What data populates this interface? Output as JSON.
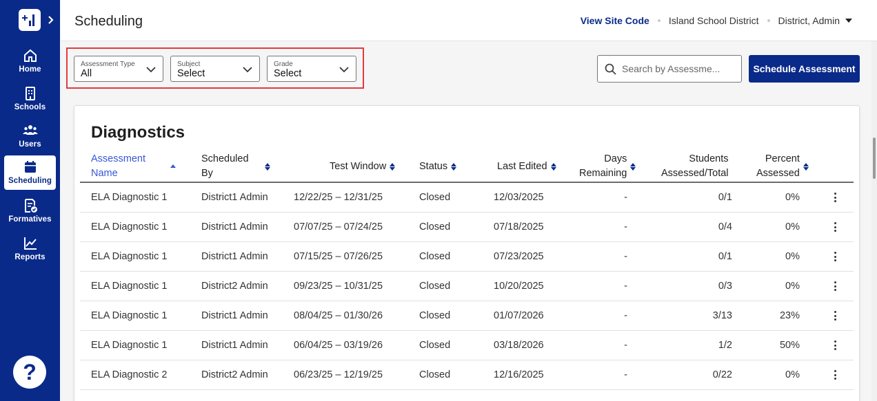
{
  "sidebar": {
    "items": [
      {
        "label": "Home",
        "icon": "home-icon"
      },
      {
        "label": "Schools",
        "icon": "school-building-icon"
      },
      {
        "label": "Users",
        "icon": "users-icon"
      },
      {
        "label": "Scheduling",
        "icon": "calendar-icon",
        "active": true
      },
      {
        "label": "Formatives",
        "icon": "document-check-icon"
      },
      {
        "label": "Reports",
        "icon": "line-chart-icon"
      }
    ],
    "help_label": "?"
  },
  "header": {
    "title": "Scheduling",
    "view_site_code": "View Site Code",
    "district": "Island School District",
    "user": "District, Admin"
  },
  "filters": {
    "assessment_type": {
      "label": "Assessment Type",
      "value": "All"
    },
    "subject": {
      "label": "Subject",
      "value": "Select"
    },
    "grade": {
      "label": "Grade",
      "value": "Select"
    }
  },
  "search": {
    "placeholder": "Search by Assessme..."
  },
  "actions": {
    "schedule_label": "Schedule Assessment"
  },
  "table": {
    "title": "Diagnostics",
    "columns": {
      "assessment_name_1": "Assessment",
      "assessment_name_2": "Name",
      "scheduled_by_1": "Scheduled",
      "scheduled_by_2": "By",
      "test_window": "Test Window",
      "status": "Status",
      "last_edited": "Last Edited",
      "days_remaining_1": "Days",
      "days_remaining_2": "Remaining",
      "students_1": "Students",
      "students_2": "Assessed/Total",
      "percent_1": "Percent",
      "percent_2": "Assessed"
    },
    "rows": [
      {
        "name": "ELA Diagnostic 1",
        "by": "District1 Admin",
        "window": "12/22/25 – 12/31/25",
        "status": "Closed",
        "edited": "12/03/2025",
        "days": "-",
        "students": "0/1",
        "percent": "0%"
      },
      {
        "name": "ELA Diagnostic 1",
        "by": "District1 Admin",
        "window": "07/07/25 – 07/24/25",
        "status": "Closed",
        "edited": "07/18/2025",
        "days": "-",
        "students": "0/4",
        "percent": "0%"
      },
      {
        "name": "ELA Diagnostic 1",
        "by": "District1 Admin",
        "window": "07/15/25 – 07/26/25",
        "status": "Closed",
        "edited": "07/23/2025",
        "days": "-",
        "students": "0/1",
        "percent": "0%"
      },
      {
        "name": "ELA Diagnostic 1",
        "by": "District2 Admin",
        "window": "09/23/25 – 10/31/25",
        "status": "Closed",
        "edited": "10/20/2025",
        "days": "-",
        "students": "0/3",
        "percent": "0%"
      },
      {
        "name": "ELA Diagnostic 1",
        "by": "District1 Admin",
        "window": "08/04/25 – 01/30/26",
        "status": "Closed",
        "edited": "01/07/2026",
        "days": "-",
        "students": "3/13",
        "percent": "23%"
      },
      {
        "name": "ELA Diagnostic 1",
        "by": "District1 Admin",
        "window": "06/04/25 – 03/19/26",
        "status": "Closed",
        "edited": "03/18/2026",
        "days": "-",
        "students": "1/2",
        "percent": "50%"
      },
      {
        "name": "ELA Diagnostic 2",
        "by": "District2 Admin",
        "window": "06/23/25 – 12/19/25",
        "status": "Closed",
        "edited": "12/16/2025",
        "days": "-",
        "students": "0/22",
        "percent": "0%"
      }
    ]
  },
  "colors": {
    "brand": "#0a2a8a",
    "link": "#3757d6",
    "highlight": "#e23b3b"
  }
}
